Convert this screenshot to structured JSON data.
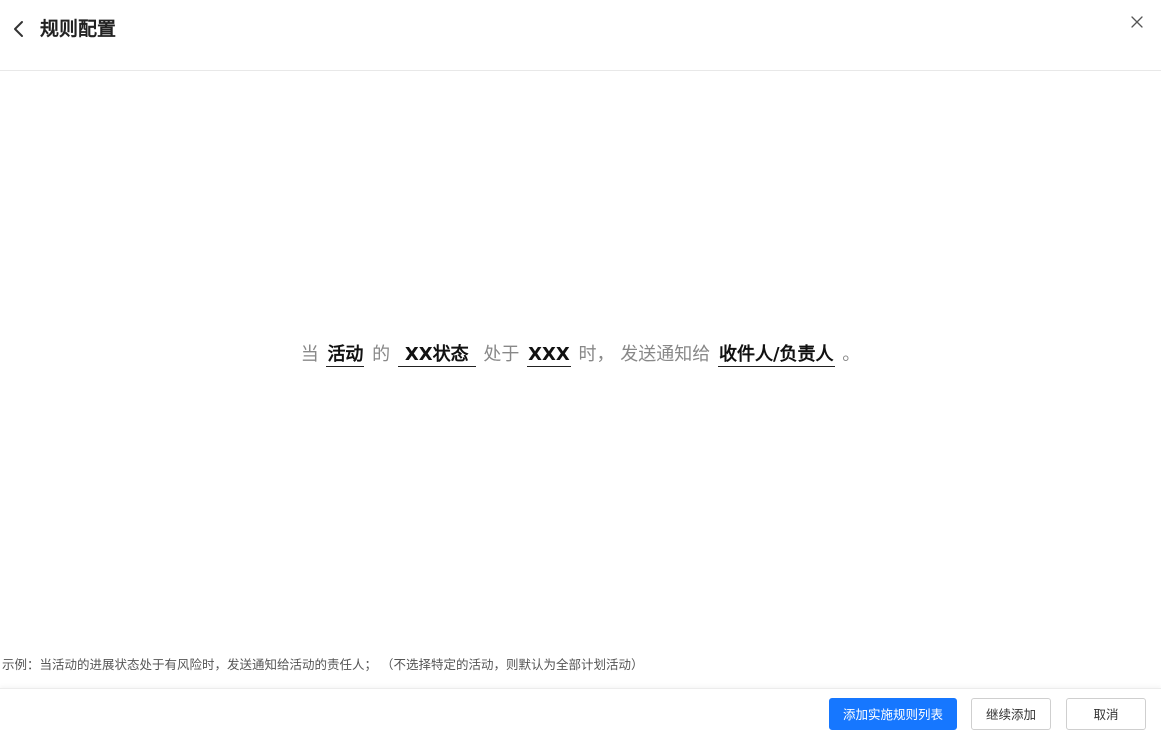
{
  "header": {
    "title": "规则配置",
    "back_icon": "chevron-left-icon",
    "close_icon": "close-icon"
  },
  "rule": {
    "when": "当",
    "object_selector": "活动",
    "of": "的",
    "state_selector": "XX状态",
    "is_in": "处于",
    "value_selector": "XXX",
    "then_send": "时， 发送通知给",
    "recipient_selector": "收件人/负责人",
    "end": "。"
  },
  "example": {
    "text": "示例：当活动的进展状态处于有风险时，发送通知给活动的责任人；  （不选择特定的活动，则默认为全部计划活动）"
  },
  "footer": {
    "primary_label": "添加实施规则列表",
    "continue_label": "继续添加",
    "cancel_label": "取消"
  },
  "colors": {
    "primary": "#1677ff",
    "text": "#333333",
    "muted": "#888888",
    "border": "#e8e8e8"
  }
}
